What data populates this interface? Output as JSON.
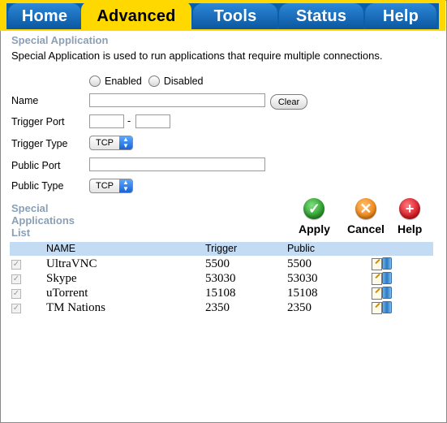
{
  "tabs": [
    {
      "label": "Home",
      "active": false
    },
    {
      "label": "Advanced",
      "active": true
    },
    {
      "label": "Tools",
      "active": false
    },
    {
      "label": "Status",
      "active": false
    },
    {
      "label": "Help",
      "active": false
    }
  ],
  "section": {
    "title": "Special Application",
    "description": "Special Application is used to run applications that require multiple connections."
  },
  "form": {
    "enabled_label": "Enabled",
    "disabled_label": "Disabled",
    "name_label": "Name",
    "name_value": "",
    "clear_label": "Clear",
    "trigger_port_label": "Trigger Port",
    "trigger_port_from": "",
    "trigger_port_to": "",
    "port_separator": "-",
    "trigger_type_label": "Trigger Type",
    "trigger_type_value": "TCP",
    "public_port_label": "Public Port",
    "public_port_value": "",
    "public_type_label": "Public Type",
    "public_type_value": "TCP"
  },
  "list": {
    "title_line1": "Special",
    "title_line2": "Applications",
    "title_line3": "List",
    "actions": {
      "apply": "Apply",
      "cancel": "Cancel",
      "help": "Help"
    },
    "columns": {
      "name": "NAME",
      "trigger": "Trigger",
      "public": "Public"
    },
    "rows": [
      {
        "name": "UltraVNC",
        "trigger": "5500",
        "public": "5500",
        "checked": true
      },
      {
        "name": "Skype",
        "trigger": "53030",
        "public": "53030",
        "checked": true
      },
      {
        "name": "uTorrent",
        "trigger": "15108",
        "public": "15108",
        "checked": true
      },
      {
        "name": "TM Nations",
        "trigger": "2350",
        "public": "2350",
        "checked": true
      }
    ]
  },
  "colors": {
    "tab_bar_yellow": "#ffd800",
    "tab_blue": "#0b5fa8",
    "section_title": "#8aa0b6",
    "table_header_bg": "#c3dbf3",
    "apply_green": "#2e9e2e",
    "cancel_orange": "#f08a1c",
    "help_red": "#d9202a"
  }
}
